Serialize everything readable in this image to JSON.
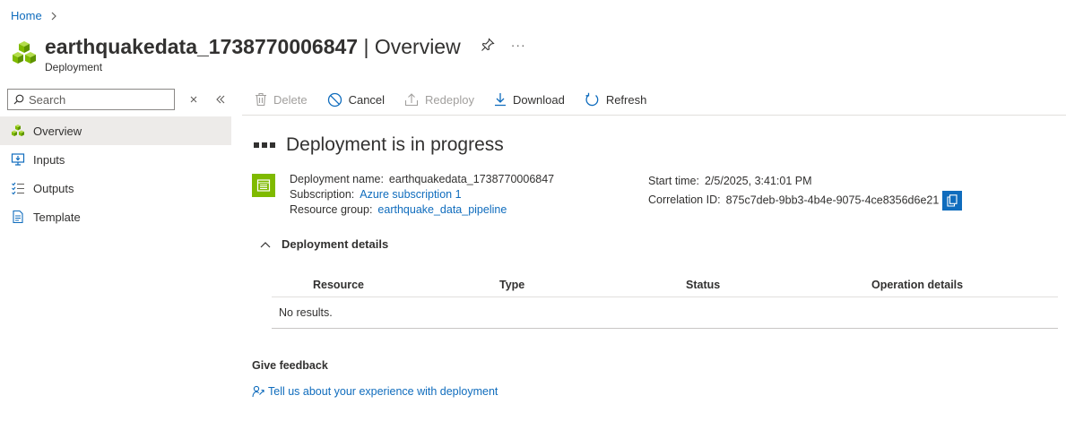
{
  "breadcrumb": {
    "home": "Home"
  },
  "header": {
    "title_name": "earthquakedata_1738770006847",
    "title_sep": " | Overview",
    "subtitle": "Deployment",
    "pin_icon": "pin-icon",
    "more_icon": "more-icon",
    "more_label": "···"
  },
  "sidebar": {
    "search_placeholder": "Search",
    "items": [
      {
        "label": "Overview",
        "icon": "overview-icon",
        "active": true
      },
      {
        "label": "Inputs",
        "icon": "inputs-icon"
      },
      {
        "label": "Outputs",
        "icon": "outputs-icon"
      },
      {
        "label": "Template",
        "icon": "template-icon"
      }
    ]
  },
  "toolbar": {
    "delete": "Delete",
    "cancel": "Cancel",
    "redeploy": "Redeploy",
    "download": "Download",
    "refresh": "Refresh"
  },
  "status": {
    "title": "Deployment is in progress"
  },
  "info": {
    "deployment_name_label": "Deployment name:",
    "deployment_name": "earthquakedata_1738770006847",
    "subscription_label": "Subscription:",
    "subscription": "Azure subscription 1",
    "resource_group_label": "Resource group:",
    "resource_group": "earthquake_data_pipeline",
    "start_time_label": "Start time:",
    "start_time": "2/5/2025, 3:41:01 PM",
    "correlation_label": "Correlation ID:",
    "correlation_id": "875c7deb-9bb3-4b4e-9075-4ce8356d6e21"
  },
  "details": {
    "heading": "Deployment details",
    "columns": [
      "Resource",
      "Type",
      "Status",
      "Operation details"
    ],
    "empty": "No results."
  },
  "feedback": {
    "title": "Give feedback",
    "link": "Tell us about your experience with deployment"
  },
  "colors": {
    "accent": "#0f6cbd",
    "green": "#7fba00",
    "nav_active": "#edebe9"
  }
}
